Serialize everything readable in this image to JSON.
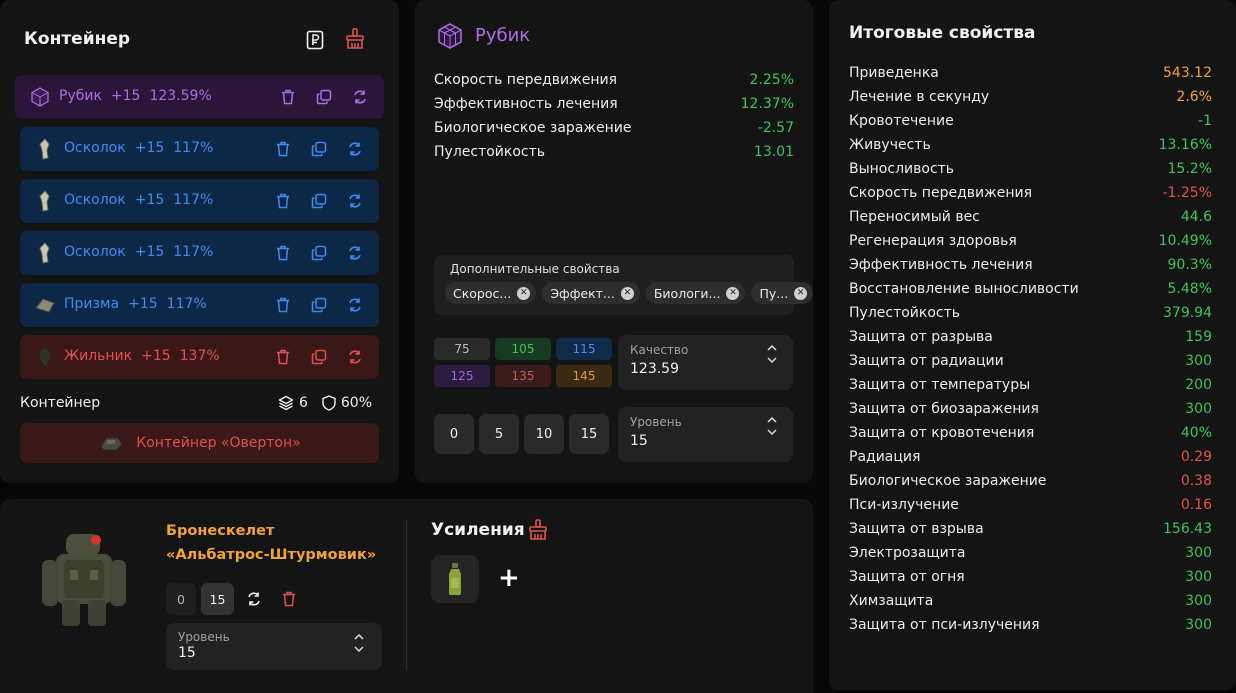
{
  "container_panel": {
    "title": "Контейнер",
    "slots": [
      {
        "name": "Рубик",
        "level": "+15",
        "percent": "123.59%",
        "variant": "purple"
      },
      {
        "name": "Осколок",
        "level": "+15",
        "percent": "117%",
        "variant": "blue"
      },
      {
        "name": "Осколок",
        "level": "+15",
        "percent": "117%",
        "variant": "blue"
      },
      {
        "name": "Осколок",
        "level": "+15",
        "percent": "117%",
        "variant": "blue"
      },
      {
        "name": "Призма",
        "level": "+15",
        "percent": "117%",
        "variant": "blue"
      },
      {
        "name": "Жильник",
        "level": "+15",
        "percent": "137%",
        "variant": "red"
      }
    ],
    "footer_label": "Контейнер",
    "capacity": "6",
    "protection": "60%",
    "container_name": "Контейнер «Овертон»"
  },
  "rubik_panel": {
    "title": "Рубик",
    "stats": [
      {
        "name": "Скорость передвижения",
        "value": "2.25%",
        "color": "green"
      },
      {
        "name": "Эффективность лечения",
        "value": "12.37%",
        "color": "green"
      },
      {
        "name": "Биологическое заражение",
        "value": "-2.57",
        "color": "green"
      },
      {
        "name": "Пулестойкость",
        "value": "13.01",
        "color": "green"
      }
    ],
    "extra_label": "Дополнительные свойства",
    "chips": [
      "Скорос...",
      "Эффект...",
      "Биологи...",
      "Пу..."
    ],
    "quality_values": [
      "75",
      "105",
      "115",
      "125",
      "135",
      "145"
    ],
    "quality_label": "Качество",
    "quality_value": "123.59",
    "level_buttons": [
      "0",
      "5",
      "10",
      "15"
    ],
    "level_label": "Уровень",
    "level_value": "15"
  },
  "armor_panel": {
    "name_line1": "Бронескелет",
    "name_line2": "«Альбатрос-Штурмовик»",
    "level_buttons": [
      "0",
      "15"
    ],
    "level_label": "Уровень",
    "level_value": "15",
    "boosts_title": "Усиления",
    "add_label": "+"
  },
  "total_panel": {
    "title": "Итоговые свойства",
    "stats": [
      {
        "name": "Приведенка",
        "value": "543.12",
        "color": "orange"
      },
      {
        "name": "Лечение в секунду",
        "value": "2.6%",
        "color": "orange"
      },
      {
        "name": "Кровотечение",
        "value": "-1",
        "color": "green"
      },
      {
        "name": "Живучесть",
        "value": "13.16%",
        "color": "green"
      },
      {
        "name": "Выносливость",
        "value": "15.2%",
        "color": "green"
      },
      {
        "name": "Скорость передвижения",
        "value": "-1.25%",
        "color": "red"
      },
      {
        "name": "Переносимый вес",
        "value": "44.6",
        "color": "green"
      },
      {
        "name": "Регенерация здоровья",
        "value": "10.49%",
        "color": "green"
      },
      {
        "name": "Эффективность лечения",
        "value": "90.3%",
        "color": "green"
      },
      {
        "name": "Восстановление выносливости",
        "value": "5.48%",
        "color": "green"
      },
      {
        "name": "Пулестойкость",
        "value": "379.94",
        "color": "green"
      },
      {
        "name": "Защита от разрыва",
        "value": "159",
        "color": "green"
      },
      {
        "name": "Защита от радиации",
        "value": "300",
        "color": "green"
      },
      {
        "name": "Защита от температуры",
        "value": "200",
        "color": "green"
      },
      {
        "name": "Защита от биозаражения",
        "value": "300",
        "color": "green"
      },
      {
        "name": "Защита от кровотечения",
        "value": "40%",
        "color": "green"
      },
      {
        "name": "Радиация",
        "value": "0.29",
        "color": "red"
      },
      {
        "name": "Биологическое заражение",
        "value": "0.38",
        "color": "red"
      },
      {
        "name": "Пси-излучение",
        "value": "0.16",
        "color": "red"
      },
      {
        "name": "Защита от взрыва",
        "value": "156.43",
        "color": "green"
      },
      {
        "name": "Электрозащита",
        "value": "300",
        "color": "green"
      },
      {
        "name": "Защита от огня",
        "value": "300",
        "color": "green"
      },
      {
        "name": "Химзащита",
        "value": "300",
        "color": "green"
      },
      {
        "name": "Защита от пси-излучения",
        "value": "300",
        "color": "green"
      }
    ]
  }
}
